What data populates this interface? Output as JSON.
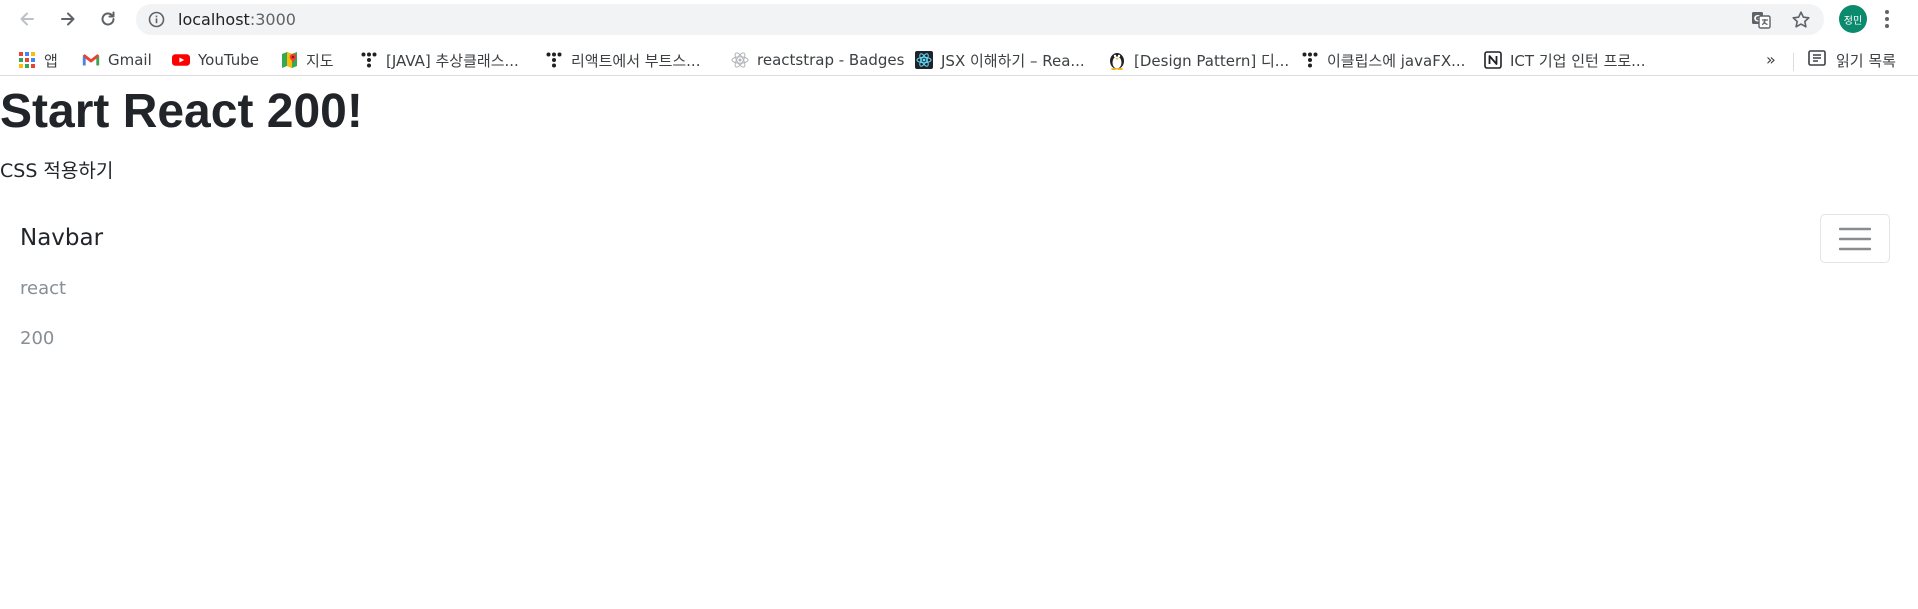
{
  "browser": {
    "url_host": "localhost",
    "url_port": ":3000",
    "profile_label": "정민"
  },
  "bookmarks": {
    "items": [
      {
        "label": "앱",
        "icon": "apps-grid-icon"
      },
      {
        "label": "Gmail",
        "icon": "gmail-icon"
      },
      {
        "label": "YouTube",
        "icon": "youtube-icon"
      },
      {
        "label": "지도",
        "icon": "maps-icon"
      },
      {
        "label": "[JAVA] 추상클래스...",
        "icon": "tistory-icon"
      },
      {
        "label": "리액트에서 부트스...",
        "icon": "tistory-icon"
      },
      {
        "label": "reactstrap - Badges",
        "icon": "react-icon"
      },
      {
        "label": "JSX 이해하기 – Rea...",
        "icon": "react-dark-icon"
      },
      {
        "label": "[Design Pattern] 디...",
        "icon": "penguin-icon"
      },
      {
        "label": "이클립스에 javaFX...",
        "icon": "tistory-icon"
      },
      {
        "label": "ICT 기업 인턴 프로...",
        "icon": "notion-icon"
      }
    ],
    "more_label": "»",
    "reading_list_label": "읽기 목록"
  },
  "page": {
    "title": "Start React 200!",
    "subtitle": "CSS 적용하기",
    "navbar": {
      "brand": "Navbar",
      "links": [
        "react",
        "200"
      ]
    }
  },
  "colors": {
    "youtube_red": "#ff0000",
    "avatar_bg": "#0b8a6d",
    "omnibox_bg": "#f1f3f4",
    "nav_link": "#868e96"
  }
}
